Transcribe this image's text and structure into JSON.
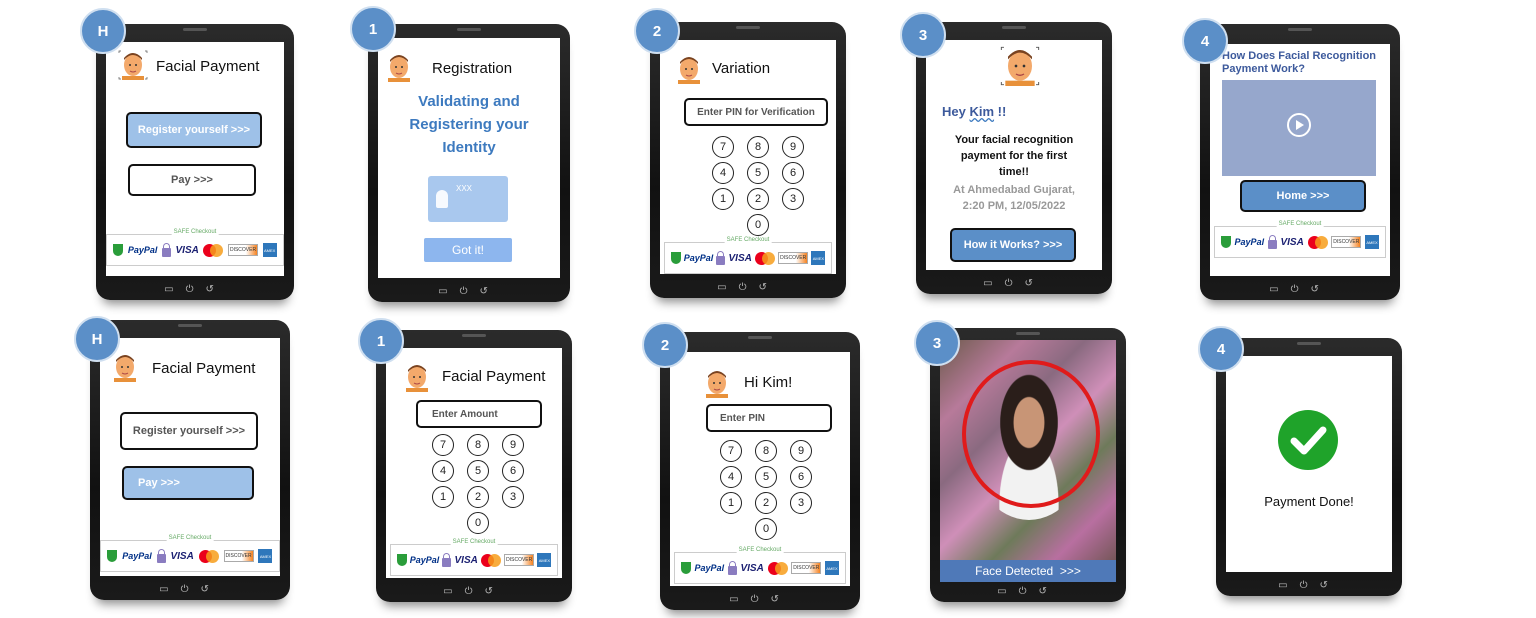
{
  "row1": {
    "t1": {
      "badge": "H",
      "title": "Facial Payment",
      "register": "Register yourself >>>",
      "pay": "Pay >>>",
      "checkout": "SAFE Checkout"
    },
    "t2": {
      "badge": "1",
      "title": "Registration",
      "heading": "Validating and Registering your Identity",
      "card_text": "XXX",
      "button": "Got it!"
    },
    "t3": {
      "badge": "2",
      "title": "Variation",
      "input": "Enter PIN for Verification",
      "keys": [
        "7",
        "8",
        "9",
        "4",
        "5",
        "6",
        "1",
        "2",
        "3",
        "0"
      ],
      "checkout": "SAFE Checkout"
    },
    "t4": {
      "badge": "3",
      "greeting_prefix": "Hey ",
      "greeting_name": "Kim",
      "greeting_suffix": " !!",
      "message": "Your facial recognition payment for the first time!!",
      "location": "At Ahmedabad Gujarat, 2:20 PM, 12/05/2022",
      "button": "How it Works? >>>"
    },
    "t5": {
      "badge": "4",
      "heading": "How Does Facial Recognition Payment Work?",
      "button": "Home   >>>",
      "checkout": "SAFE Checkout"
    }
  },
  "row2": {
    "t1": {
      "badge": "H",
      "title": "Facial Payment",
      "register": "Register yourself >>>",
      "pay": "Pay >>>",
      "checkout": "SAFE Checkout"
    },
    "t2": {
      "badge": "1",
      "title": "Facial Payment",
      "input": "Enter Amount",
      "keys": [
        "7",
        "8",
        "9",
        "4",
        "5",
        "6",
        "1",
        "2",
        "3",
        "0"
      ],
      "checkout": "SAFE Checkout"
    },
    "t3": {
      "badge": "2",
      "title": "Hi Kim!",
      "input": "Enter PIN",
      "keys": [
        "7",
        "8",
        "9",
        "4",
        "5",
        "6",
        "1",
        "2",
        "3",
        "0"
      ],
      "checkout": "SAFE Checkout"
    },
    "t4": {
      "badge": "3",
      "status": "Face Detected  >>>"
    },
    "t5": {
      "badge": "4",
      "message": "Payment Done!"
    }
  },
  "payment_icons": [
    "shield-icon",
    "paypal-icon",
    "lock-icon",
    "visa-icon",
    "mastercard-icon",
    "discover-icon",
    "amex-icon"
  ],
  "paypal_text": "PayPal",
  "visa_text": "VISA",
  "discover_text": "DISCOVER",
  "amex_text": "AMEX",
  "colors": {
    "accent": "#5b8fc8",
    "light_blue": "#9ec1e8",
    "success": "#1fa32a",
    "face_frame": "#e01b1b"
  }
}
